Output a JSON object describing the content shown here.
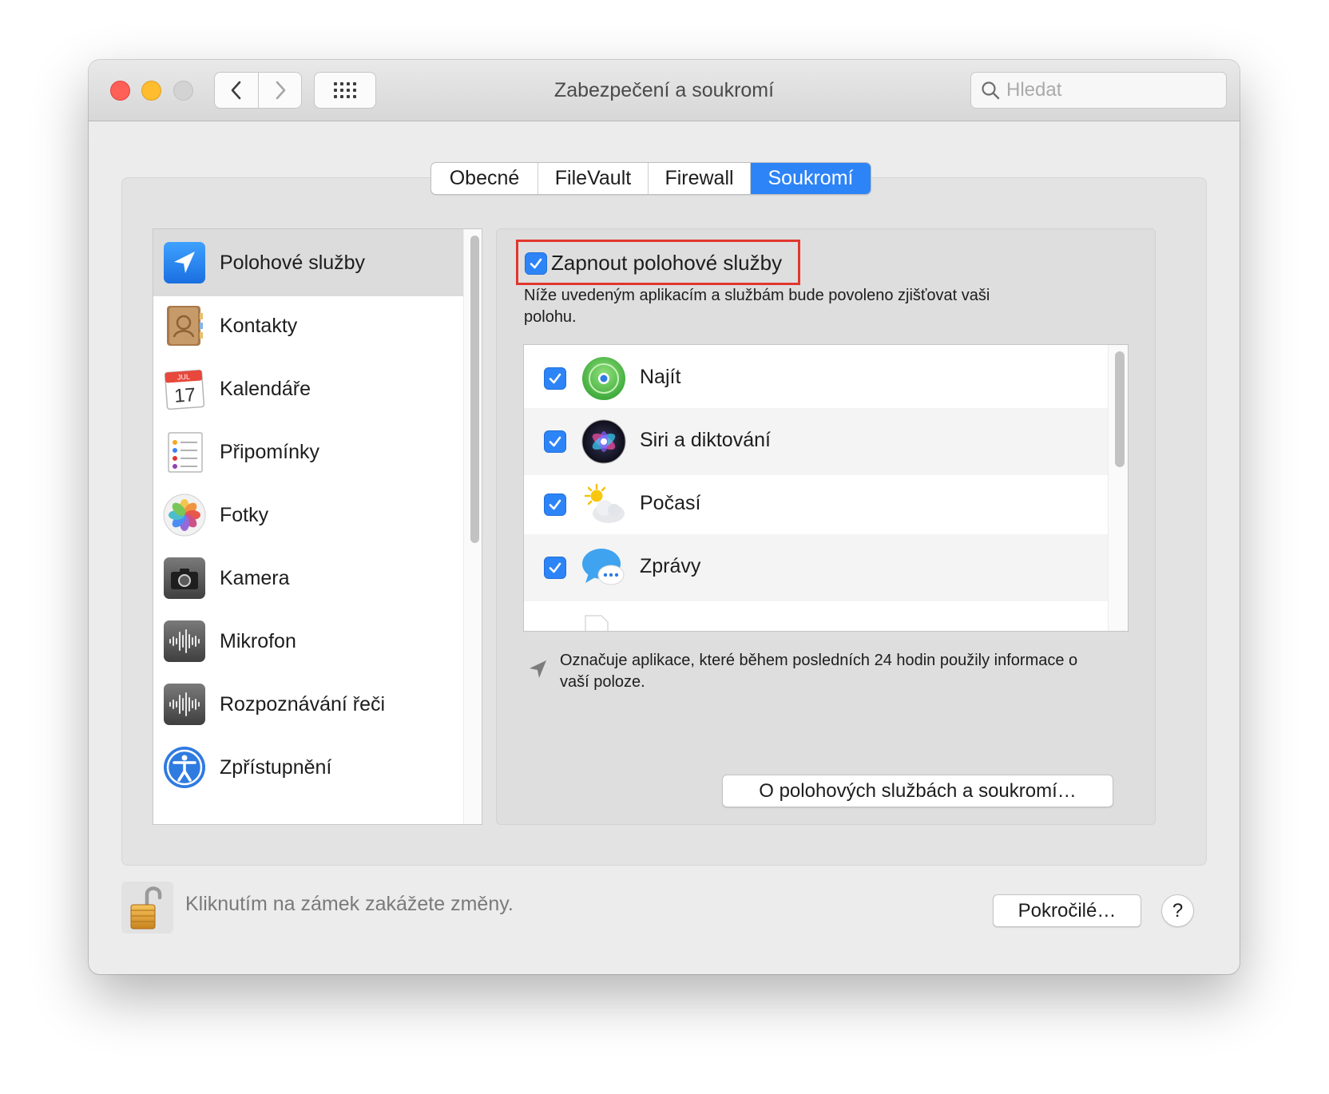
{
  "window": {
    "title": "Zabezpečení a soukromí",
    "search_placeholder": "Hledat"
  },
  "tabs": [
    {
      "label": "Obecné",
      "active": false
    },
    {
      "label": "FileVault",
      "active": false
    },
    {
      "label": "Firewall",
      "active": false
    },
    {
      "label": "Soukromí",
      "active": true
    }
  ],
  "sidebar": {
    "items": [
      {
        "label": "Polohové služby",
        "icon": "location-arrow-icon",
        "selected": true
      },
      {
        "label": "Kontakty",
        "icon": "contacts-icon"
      },
      {
        "label": "Kalendáře",
        "icon": "calendar-icon"
      },
      {
        "label": "Připomínky",
        "icon": "reminders-icon"
      },
      {
        "label": "Fotky",
        "icon": "photos-icon"
      },
      {
        "label": "Kamera",
        "icon": "camera-icon"
      },
      {
        "label": "Mikrofon",
        "icon": "microphone-icon"
      },
      {
        "label": "Rozpoznávání řeči",
        "icon": "speech-recognition-icon"
      },
      {
        "label": "Zpřístupnění",
        "icon": "accessibility-icon"
      }
    ],
    "calendar_month": "JUL",
    "calendar_day": "17"
  },
  "location": {
    "enable_label": "Zapnout polohové služby",
    "enabled": true,
    "description": "Níže uvedeným aplikacím a službám bude povoleno zjišťovat vaši polohu.",
    "apps": [
      {
        "label": "Najít",
        "checked": true,
        "icon": "find-my-icon"
      },
      {
        "label": "Siri a diktování",
        "checked": true,
        "icon": "siri-icon"
      },
      {
        "label": "Počasí",
        "checked": true,
        "icon": "weather-icon"
      },
      {
        "label": "Zprávy",
        "checked": true,
        "icon": "messages-icon"
      }
    ],
    "note": "Označuje aplikace, které během posledních 24 hodin použily informace o vaší poloze.",
    "about_button": "O polohových službách a soukromí…"
  },
  "footer": {
    "lock_text": "Kliknutím na zámek zakážete změny.",
    "advanced_button": "Pokročilé…",
    "help_button": "?"
  },
  "colors": {
    "accent": "#2d84f7",
    "highlight": "#e0372d",
    "traffic_close": "#fe5f57",
    "traffic_min": "#febc2e"
  }
}
